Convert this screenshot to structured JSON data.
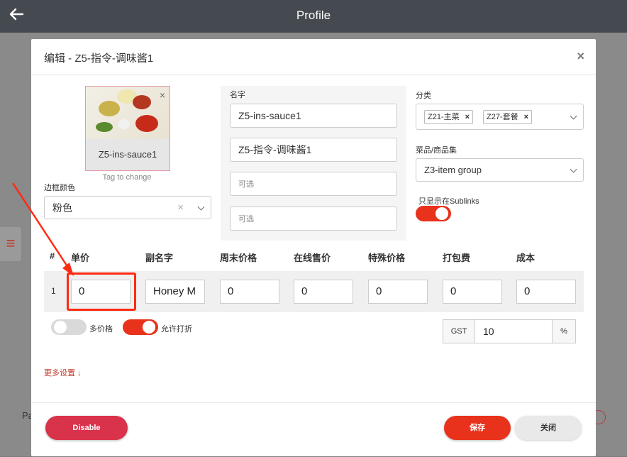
{
  "header": {
    "title": "Profile",
    "back_icon": "arrow-left-icon"
  },
  "background": {
    "footer_text": "Pa",
    "menu_icon": "hamburger-icon"
  },
  "modal": {
    "title": "编辑 - Z5-指令-调味酱1",
    "close_glyph": "×",
    "image": {
      "label": "Z5-ins-sauce1",
      "remove_glyph": "×",
      "hint": "Tag to change"
    },
    "border_color": {
      "label": "边框颜色",
      "value": "粉色",
      "clear_glyph": "×"
    },
    "name": {
      "label": "名字",
      "fields": [
        {
          "value": "Z5-ins-sauce1",
          "placeholder": ""
        },
        {
          "value": "Z5-指令-调味酱1",
          "placeholder": ""
        },
        {
          "value": "",
          "placeholder": "可选"
        },
        {
          "value": "",
          "placeholder": "可选"
        }
      ]
    },
    "category": {
      "label": "分类",
      "tags": [
        {
          "text": "Z21-主菜",
          "x": "×"
        },
        {
          "text": "Z27-套餐",
          "x": "×"
        }
      ]
    },
    "item_set": {
      "label": "菜品/商品集",
      "value": "Z3-item group"
    },
    "sublinks_only": {
      "label": "只显示在Sublinks",
      "on": true
    },
    "price_table": {
      "headers": [
        "#",
        "单价",
        "副名字",
        "周末价格",
        "在线售价",
        "特殊价格",
        "打包费",
        "成本"
      ],
      "row": {
        "index": "1",
        "cells": [
          "0",
          "Honey M",
          "0",
          "0",
          "0",
          "0",
          "0"
        ]
      }
    },
    "multi_price": {
      "label": "多价格",
      "on": false
    },
    "allow_discount": {
      "label": "允许打折",
      "on": true
    },
    "gst": {
      "label": "GST",
      "value": "10",
      "unit": "%"
    },
    "more_settings": "更多设置 ↓",
    "buttons": {
      "disable": "Disable",
      "save": "保存",
      "close": "关闭"
    }
  },
  "colors": {
    "accent": "#e8321c",
    "disable": "#d9324b",
    "header": "#454a50",
    "annotation": "#ff2a12"
  }
}
